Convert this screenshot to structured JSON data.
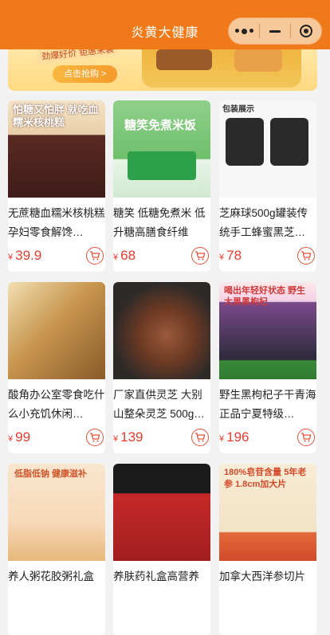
{
  "app": {
    "title": "炎黄大健康"
  },
  "banner": {
    "tag_text": "劲爆好价 钜惠来袭",
    "button_label": "点击抢购 >"
  },
  "products": [
    {
      "name": "无蔗糖血糯米核桃糕孕妇零食解馋…",
      "price": "39.9",
      "currency": "¥",
      "img_text": "怕糖又怕胖 就吃血糯米核桃糕",
      "img_colors": [
        "#f3e2c7",
        "#5a2a22"
      ]
    },
    {
      "name": "糖笑 低糖免煮米 低升糖高膳食纤维",
      "price": "68",
      "currency": "¥",
      "img_text": "糖笑免煮米饭",
      "img_colors": [
        "#7cc47a",
        "#ffffff"
      ]
    },
    {
      "name": "芝麻球500g罐装传统手工蜂蜜黑芝…",
      "price": "78",
      "currency": "¥",
      "img_text": "包装展示",
      "img_colors": [
        "#f7f7f7",
        "#2a2a2a"
      ]
    },
    {
      "name": "酸角办公室零食吃什么小充饥休闲…",
      "price": "99",
      "currency": "¥",
      "img_text": "",
      "img_colors": [
        "#f1dfb2",
        "#8a5a2a"
      ]
    },
    {
      "name": "厂家直供灵芝 大别山整朵灵芝 500g…",
      "price": "139",
      "currency": "¥",
      "img_text": "",
      "img_colors": [
        "#2e2a28",
        "#9a5a3a"
      ]
    },
    {
      "name": "野生黑枸杞子干青海正品宁夏特级…",
      "price": "196",
      "currency": "¥",
      "img_text": "喝出年轻好状态 野生大果黑枸杞",
      "img_colors": [
        "#c88ad6",
        "#d23a3a"
      ]
    },
    {
      "name": "养人粥花胶粥礼盒",
      "price": "",
      "currency": "¥",
      "img_text": "低脂低钠 健康滋补",
      "img_colors": [
        "#f7d9b8",
        "#d0562a"
      ]
    },
    {
      "name": "养肤药礼盒高营养",
      "price": "",
      "currency": "¥",
      "img_text": "",
      "img_colors": [
        "#1a1a1a",
        "#c62828"
      ]
    },
    {
      "name": "加拿大西洋参切片",
      "price": "",
      "currency": "¥",
      "img_text": "180%皂苷含量 5年老参 1.8cm加大片",
      "img_colors": [
        "#f2e3c4",
        "#d24a2a"
      ]
    }
  ]
}
